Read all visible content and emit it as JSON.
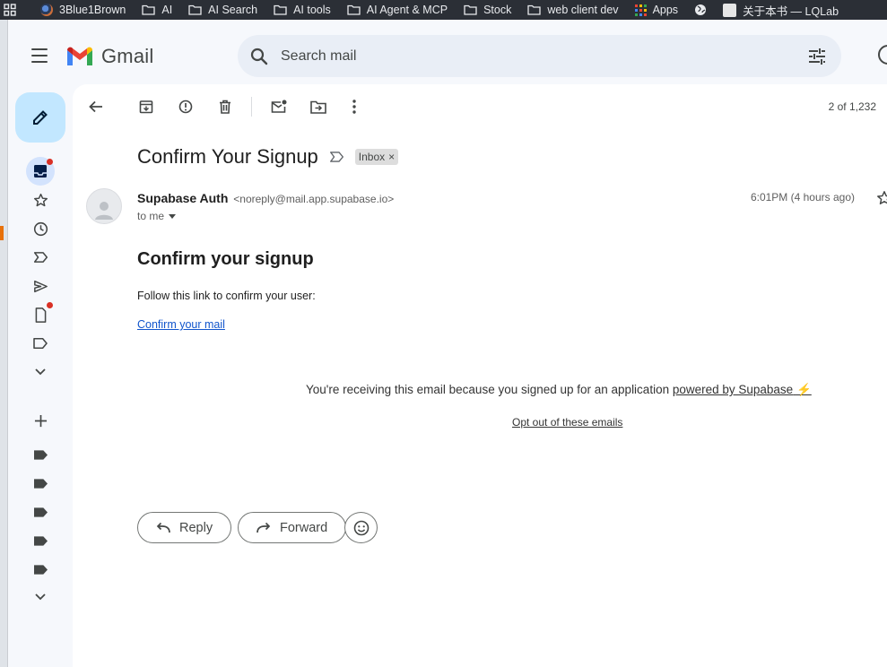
{
  "bookmarks": [
    {
      "label": "3Blue1Brown",
      "icon": "site-favicon-icon"
    },
    {
      "label": "AI",
      "icon": "folder-icon"
    },
    {
      "label": "AI Search",
      "icon": "folder-icon"
    },
    {
      "label": "AI tools",
      "icon": "folder-icon"
    },
    {
      "label": "AI Agent & MCP",
      "icon": "folder-icon"
    },
    {
      "label": "Stock",
      "icon": "folder-icon"
    },
    {
      "label": "web client dev",
      "icon": "folder-icon"
    },
    {
      "label": "Apps",
      "icon": "apps-grid-icon"
    },
    {
      "label": "",
      "icon": "globe-icon"
    },
    {
      "label": "关于本书 — LQLab",
      "icon": "site-favicon-icon"
    }
  ],
  "header": {
    "app_name": "Gmail",
    "search_placeholder": "Search mail"
  },
  "toolbar": {
    "pager": "2 of 1,232"
  },
  "email": {
    "subject": "Confirm Your Signup",
    "label_chip": "Inbox",
    "chip_close": "×",
    "sender_name": "Supabase Auth",
    "sender_email": "<noreply@mail.app.supabase.io>",
    "to": "to me",
    "time": "6:01PM (4 hours ago)",
    "heading": "Confirm your signup",
    "paragraph": "Follow this link to confirm your user:",
    "link": "Confirm your mail",
    "footer_text": "You're receiving this email because you signed up for an application ",
    "footer_link": "powered by Supabase",
    "footer_bolt": "⚡",
    "optout": "Opt out of these emails"
  },
  "actions": {
    "reply": "Reply",
    "forward": "Forward"
  },
  "colors": {
    "compose_bg": "#c2e7ff",
    "link": "#1155cc",
    "badge_dot": "#d93025"
  }
}
